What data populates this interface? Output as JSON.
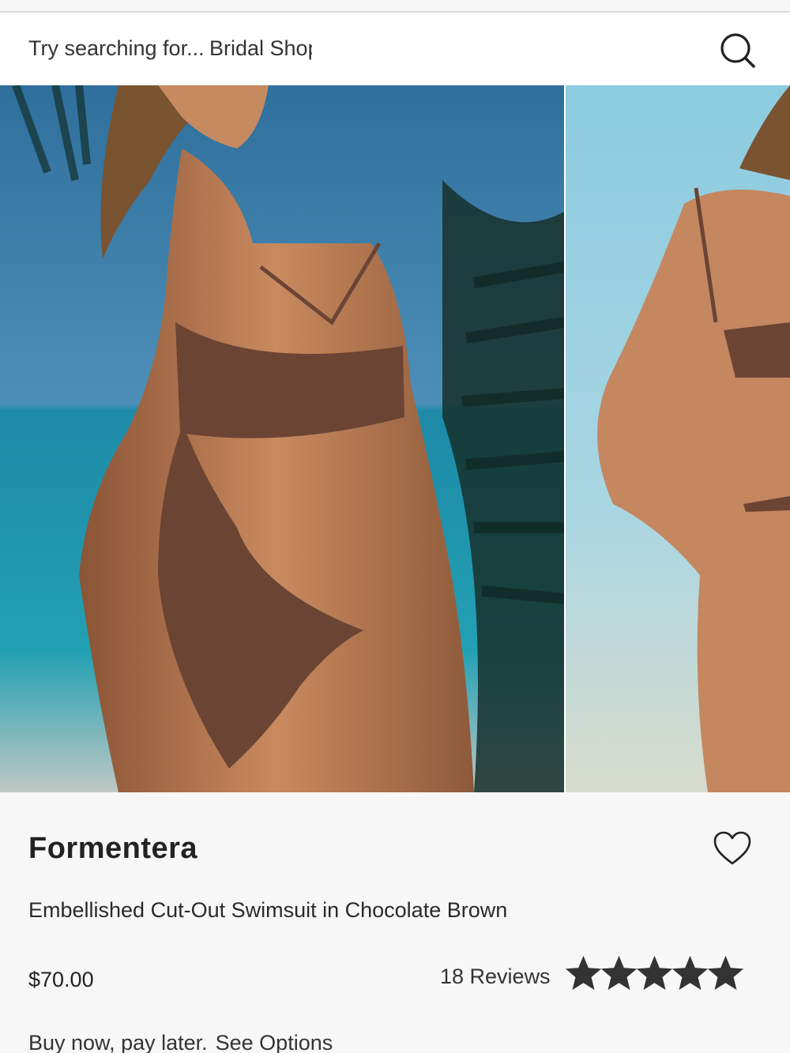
{
  "search": {
    "prompt": "Try searching for...",
    "suggestion": "Bridal Shop"
  },
  "gallery": {
    "images": [
      {
        "alt": "Model wearing swimsuit, front view"
      },
      {
        "alt": "Model wearing swimsuit, back view"
      }
    ]
  },
  "product": {
    "brand": "Formentera",
    "name": "Embellished Cut-Out Swimsuit in Chocolate Brown",
    "price": "$70.00",
    "reviews_label": "18 Reviews",
    "rating": 5,
    "rating_max": 5,
    "bnpl_text": "Buy now, pay later.",
    "bnpl_link": "See Options"
  },
  "icons": {
    "search": "search-icon",
    "wishlist": "heart-outline-icon",
    "star": "star-icon"
  },
  "colors": {
    "text": "#222222",
    "star": "#333333",
    "panel_bg": "#f7f7f7",
    "swimsuit": "#6b4434"
  }
}
